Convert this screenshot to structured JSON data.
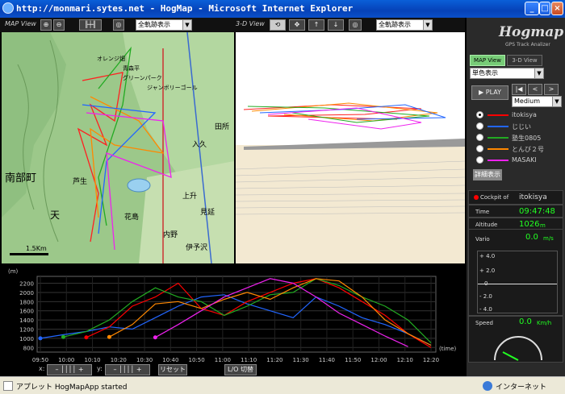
{
  "window": {
    "title": "http://monmari.sytes.net - HogMap - Microsoft Internet Explorer"
  },
  "map": {
    "label": "MAP View",
    "select": "全軌跡表示",
    "scale": "1.5Km",
    "places": [
      "オレンジ畑",
      "青森平",
      "グリーンパーク",
      "ジャンボリーゴール",
      "南部町",
      "芦生",
      "花島",
      "上升",
      "天",
      "内野",
      "伊予沢",
      "見延",
      "入久",
      "田所"
    ]
  },
  "view3d": {
    "label": "3-D View",
    "select": "全軌跡表示"
  },
  "side": {
    "logo": "Hogmap",
    "sub": "GPS Track Analizer",
    "map_view": "MAP View",
    "view3d": "3-D View",
    "color_select": "単色表示",
    "play": "PLAY",
    "speed": "Medium",
    "players": [
      {
        "name": "itokisya",
        "color": "#ff0000",
        "selected": true
      },
      {
        "name": "じじい",
        "color": "#2266ff",
        "selected": false
      },
      {
        "name": "塾生0805",
        "color": "#22aa22",
        "selected": false
      },
      {
        "name": "とんび２号",
        "color": "#ff8800",
        "selected": false
      },
      {
        "name": "MASAKI",
        "color": "#ee22ee",
        "selected": false
      }
    ],
    "detail_btn": "詳細表示"
  },
  "cockpit": {
    "label": "Cockpit of",
    "pilot": "itokisya",
    "time_label": "Time",
    "time": "09:47:48",
    "alt_label": "Altitude",
    "alt": "1026",
    "alt_unit": "m",
    "vario_label": "Vario",
    "vario": "0.0",
    "vario_unit": "m/s",
    "vario_ticks": [
      "+ 4.0",
      "+ 2.0",
      "0",
      "- 2.0",
      "- 4.0"
    ],
    "speed_label": "Speed",
    "speed": "0.0",
    "speed_unit": "Km/h"
  },
  "controls": {
    "x": "x:",
    "y": "y:",
    "reset": "リセット",
    "lod": "L/O 切替"
  },
  "status": {
    "left": "アプレット HogMapApp started",
    "right": "インターネット"
  },
  "chart_data": {
    "type": "line",
    "ylabel": "(m)",
    "xlabel": "(time)",
    "x": [
      "09:50",
      "10:00",
      "10:10",
      "10:20",
      "10:30",
      "10:40",
      "10:50",
      "11:00",
      "11:10",
      "11:20",
      "11:30",
      "11:40",
      "11:50",
      "12:00",
      "12:10",
      "12:20"
    ],
    "yticks": [
      800,
      1000,
      1200,
      1400,
      1600,
      1800,
      2000,
      2200
    ],
    "ylim": [
      700,
      2350
    ],
    "series": [
      {
        "name": "じじい",
        "color": "#2266ff",
        "values": [
          1000,
          1080,
          1150,
          1250,
          1200,
          1450,
          1700,
          1900,
          1950,
          1750,
          1600,
          1450,
          1900,
          1700,
          1450,
          1300,
          1100,
          850
        ]
      },
      {
        "name": "itokisya",
        "color": "#ff0000",
        "values": [
          null,
          null,
          1020,
          1250,
          1700,
          1900,
          2200,
          1650,
          1500,
          1800,
          2000,
          2200,
          2300,
          2100,
          1800,
          1500,
          1100,
          800
        ]
      },
      {
        "name": "塾生0805",
        "color": "#22aa22",
        "values": [
          null,
          1030,
          1150,
          1400,
          1800,
          2100,
          1900,
          1800,
          1500,
          1700,
          1950,
          2000,
          2300,
          2150,
          1900,
          1700,
          1400,
          900
        ]
      },
      {
        "name": "とんび２号",
        "color": "#ff8800",
        "values": [
          null,
          null,
          null,
          1030,
          1300,
          1750,
          1800,
          1650,
          1850,
          2000,
          1850,
          2100,
          2300,
          2250,
          1900,
          1400,
          1100,
          850
        ]
      },
      {
        "name": "MASAKI",
        "color": "#ee22ee",
        "values": [
          null,
          null,
          null,
          null,
          null,
          1020,
          1300,
          1600,
          1900,
          2100,
          2300,
          2200,
          1900,
          1550,
          1300,
          1050,
          820,
          null
        ]
      }
    ]
  }
}
